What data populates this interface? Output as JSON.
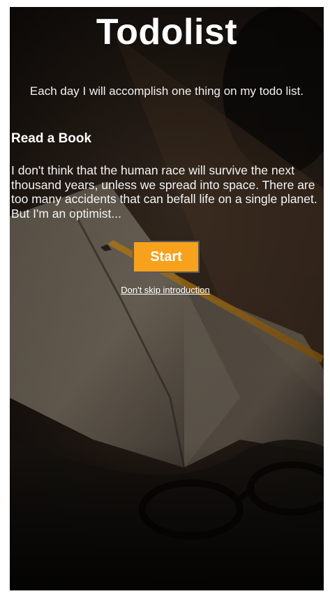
{
  "header": {
    "title": "Todolist",
    "tagline": "Each day I will accomplish one thing on my todo list."
  },
  "book": {
    "title": "Read a Book",
    "excerpt": "I don't think that the human race will survive the next thousand years, unless we spread into space. There are too many accidents that can befall life on a single planet. But I'm an optimist..."
  },
  "actions": {
    "start_label": "Start",
    "intro_link_label": "Don't skip introduction"
  },
  "colors": {
    "accent": "#f7a11d",
    "text": "#ffffff",
    "background": "#171310"
  },
  "background_image": "open-notebook-with-pencil-and-glasses"
}
